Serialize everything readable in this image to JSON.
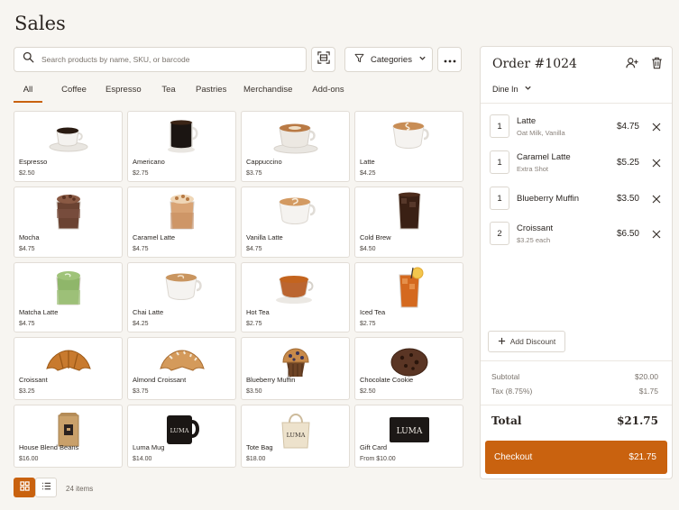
{
  "page": {
    "title": "Sales"
  },
  "search": {
    "placeholder": "Search products by name, SKU, or barcode",
    "value": ""
  },
  "toolbar": {
    "categories_label": "Categories"
  },
  "tabs": [
    {
      "label": "All",
      "active": true
    },
    {
      "label": "Coffee"
    },
    {
      "label": "Espresso"
    },
    {
      "label": "Tea"
    },
    {
      "label": "Pastries"
    },
    {
      "label": "Merchandise"
    },
    {
      "label": "Add-ons"
    }
  ],
  "products": [
    {
      "name": "Espresso",
      "price": "$2.50",
      "icon": "espresso-cup"
    },
    {
      "name": "Americano",
      "price": "$2.75",
      "icon": "americano-mug"
    },
    {
      "name": "Cappuccino",
      "price": "$3.75",
      "icon": "cappuccino-cup"
    },
    {
      "name": "Latte",
      "price": "$4.25",
      "icon": "latte-cup"
    },
    {
      "name": "Mocha",
      "price": "$4.75",
      "icon": "mocha-glass"
    },
    {
      "name": "Caramel Latte",
      "price": "$4.75",
      "icon": "caramel-latte-glass"
    },
    {
      "name": "Vanilla Latte",
      "price": "$4.75",
      "icon": "vanilla-latte-cup"
    },
    {
      "name": "Cold Brew",
      "price": "$4.50",
      "icon": "cold-brew-glass"
    },
    {
      "name": "Matcha Latte",
      "price": "$4.75",
      "icon": "matcha-glass"
    },
    {
      "name": "Chai Latte",
      "price": "$4.25",
      "icon": "chai-cup"
    },
    {
      "name": "Hot Tea",
      "price": "$2.75",
      "icon": "tea-cup"
    },
    {
      "name": "Iced Tea",
      "price": "$2.75",
      "icon": "iced-tea-glass"
    },
    {
      "name": "Croissant",
      "price": "$3.25",
      "icon": "croissant"
    },
    {
      "name": "Almond Croissant",
      "price": "$3.75",
      "icon": "almond-croissant"
    },
    {
      "name": "Blueberry Muffin",
      "price": "$3.50",
      "icon": "muffin"
    },
    {
      "name": "Chocolate Cookie",
      "price": "$2.50",
      "icon": "cookie"
    },
    {
      "name": "House Blend Beans",
      "price": "$16.00",
      "icon": "coffee-bag"
    },
    {
      "name": "Luma Mug",
      "price": "$14.00",
      "icon": "mug",
      "brand": "LUMA"
    },
    {
      "name": "Tote Bag",
      "price": "$18.00",
      "icon": "tote-bag",
      "brand": "LUMA"
    },
    {
      "name": "Gift Card",
      "price": "From $10.00",
      "icon": "gift-card",
      "brand": "LUMA"
    }
  ],
  "footer": {
    "item_count": "24 items"
  },
  "order": {
    "title": "Order #1024",
    "service_mode": "Dine In",
    "lines": [
      {
        "qty": "1",
        "name": "Latte",
        "modifiers": "Oat Milk, Vanilla",
        "price": "$4.75"
      },
      {
        "qty": "1",
        "name": "Caramel Latte",
        "modifiers": "Extra Shot",
        "price": "$5.25"
      },
      {
        "qty": "1",
        "name": "Blueberry Muffin",
        "modifiers": "",
        "price": "$3.50"
      },
      {
        "qty": "2",
        "name": "Croissant",
        "modifiers": "$3.25 each",
        "price": "$6.50"
      }
    ],
    "add_discount_label": "Add Discount",
    "subtotal_label": "Subtotal",
    "subtotal": "$20.00",
    "tax_label": "Tax (8.75%)",
    "tax": "$1.75",
    "total_label": "Total",
    "total": "$21.75",
    "checkout_label": "Checkout",
    "checkout_amount": "$21.75"
  },
  "colors": {
    "accent": "#c9620f",
    "background": "#f7f5f1",
    "card": "#ffffff",
    "border": "#e2ddd6"
  }
}
